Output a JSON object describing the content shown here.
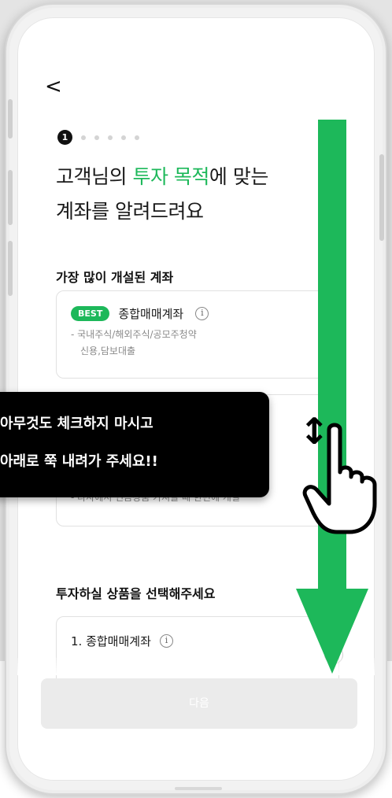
{
  "header": {
    "back_icon": "chevron-left-icon",
    "back_glyph": "<"
  },
  "steps": {
    "current": "1",
    "total": 6
  },
  "headline": {
    "line1_prefix": "고객님의 ",
    "line1_highlight": "투자 목적",
    "line1_suffix": "에 맞는",
    "line2": "계좌를 알려드려요",
    "highlight_color": "#1db85a"
  },
  "popular": {
    "title": "가장 많이 개설된 계좌",
    "card1": {
      "badge": "BEST",
      "name": "종합매매계좌",
      "info_glyph": "i",
      "desc_line1": "- 국내주식/해외주식/공모주청약",
      "desc_line2": "신용,담보대출"
    },
    "card2": {
      "desc": "- 타사에서 연금상품 가져올 때 한번에 개설"
    }
  },
  "tooltip": {
    "line1": "아무것도 체크하지 마시고",
    "line2": "아래로 쭉 내려가 주세요!!"
  },
  "products": {
    "title": "투자하실 상품을 선택해주세요",
    "item1": {
      "name": "1. 종합매매계좌",
      "info_glyph": "i"
    }
  },
  "footer": {
    "next_label": "다음"
  },
  "gesture": {
    "updown_glyph": "↕",
    "hand_icon": "pointing-hand-icon",
    "arrow_icon": "down-arrow-icon"
  },
  "colors": {
    "accent": "#1db85a",
    "tooltip_bg": "#000000"
  }
}
